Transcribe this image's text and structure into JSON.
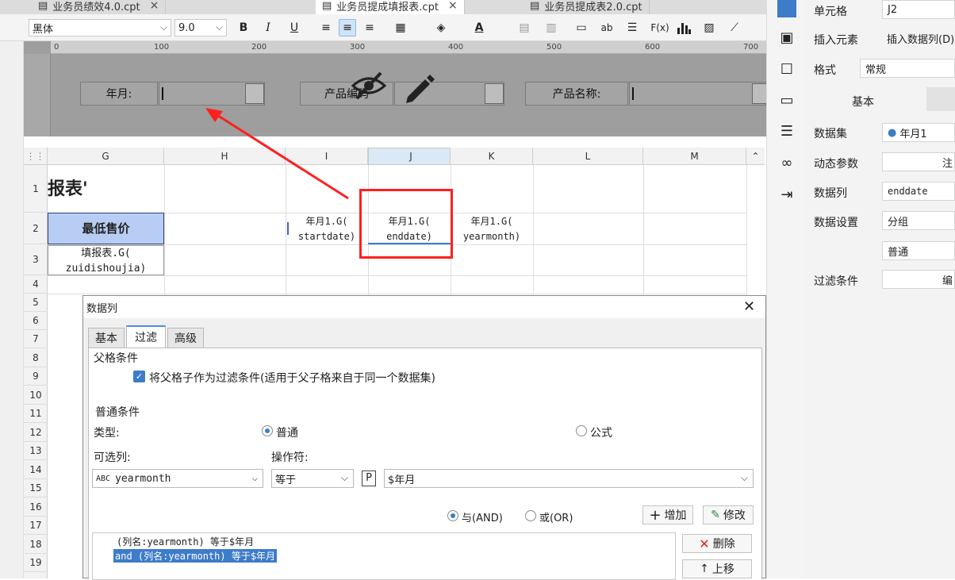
{
  "tabs": [
    {
      "label": "业务员绩效4.0.cpt",
      "active": false
    },
    {
      "label": "业务员提成填报表.cpt",
      "active": true
    },
    {
      "label": "业务员提成表2.0.cpt",
      "active": false
    }
  ],
  "toolbar": {
    "font_name": "黑体",
    "font_size": "9.0",
    "bold_label": "B",
    "italic_label": "I",
    "underline_label": "U",
    "fx_label": "F(x)",
    "ab_label": "ab"
  },
  "ruler": {
    "ticks": [
      "0",
      "100",
      "200",
      "300",
      "400",
      "500",
      "600",
      "700"
    ]
  },
  "params": {
    "year_month_label": "年月:",
    "product_code_label": "产品编码",
    "product_name_label": "产品名称:"
  },
  "grid": {
    "columns": [
      "G",
      "H",
      "I",
      "J",
      "K",
      "L",
      "M"
    ],
    "selected_column": "J",
    "rows": [
      "1",
      "2",
      "3",
      "4",
      "5",
      "6",
      "7",
      "8",
      "9",
      "10",
      "11",
      "12",
      "13",
      "14",
      "15",
      "16",
      "17",
      "18",
      "19"
    ],
    "title_fragment": "报表'",
    "header_cell": "最低售价",
    "cell_g3": "填报表.G(\nzuidishoujia)",
    "cell_i2": "年月1.G(\nstartdate)",
    "cell_j2": "年月1.G(\nenddate)",
    "cell_k2": "年月1.G(\nyearmonth)"
  },
  "props": {
    "cell_label": "单元格",
    "cell_value": "J2",
    "insert_label": "插入元素",
    "insert_value": "插入数据列(D)",
    "format_label": "格式",
    "format_value": "常规",
    "basic_tab": "基本",
    "dataset_label": "数据集",
    "dataset_value": "年月1",
    "dynamic_label": "动态参数",
    "dynamic_value": "注",
    "column_label": "数据列",
    "column_value": "enddate",
    "setting_label": "数据设置",
    "setting_value": "分组",
    "setting_value2": "普通",
    "filter_label": "过滤条件",
    "filter_value": "编"
  },
  "dialog": {
    "title": "数据列",
    "tabs": [
      "基本",
      "过滤",
      "高级"
    ],
    "active_tab": "过滤",
    "parent_section": "父格条件",
    "parent_checkbox_label": "将父格子作为过滤条件(适用于父子格来自于同一个数据集)",
    "common_section": "普通条件",
    "type_label": "类型:",
    "radio_normal": "普通",
    "radio_formula": "公式",
    "col_label": "可选列:",
    "op_label": "操作符:",
    "col_value": "yearmonth",
    "op_value": "等于",
    "param_badge": "P",
    "param_value": "$年月",
    "and_label": "与(AND)",
    "or_label": "或(OR)",
    "add_button": "增加",
    "modify_button": "修改",
    "delete_button": "删除",
    "up_button": "上移",
    "conditions": [
      {
        "text": "(列名:yearmonth) 等于$年月",
        "selected": false
      },
      {
        "text": "and (列名:yearmonth) 等于$年月",
        "selected": true
      }
    ]
  },
  "colors": {
    "accent_blue": "#3d7cc9",
    "annotation_red": "#ff2020",
    "header_cell_bg": "#b8cdf3"
  }
}
